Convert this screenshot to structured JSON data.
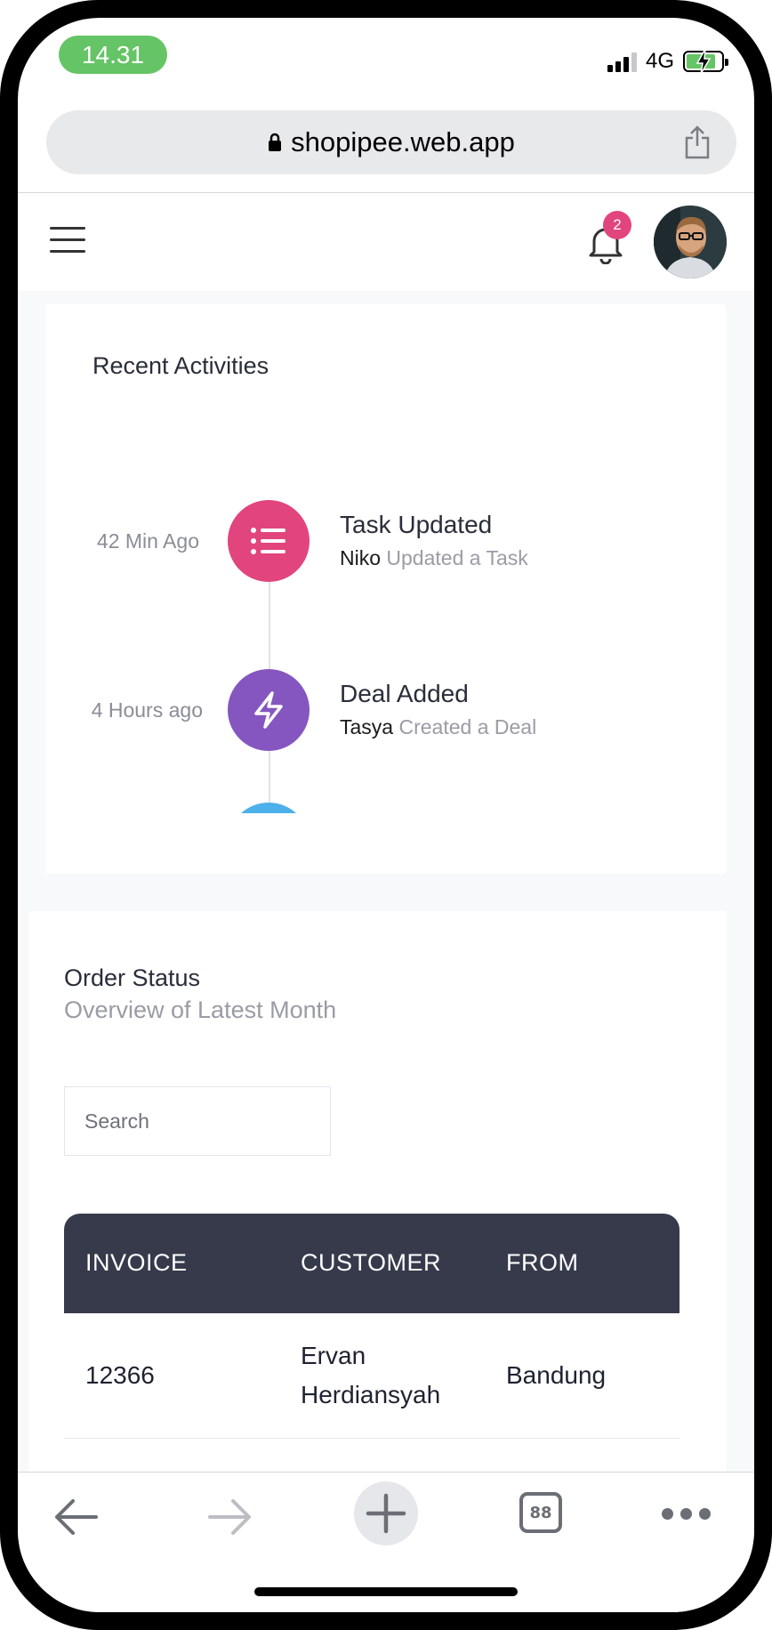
{
  "status_bar": {
    "time": "14.31",
    "network": "4G",
    "battery_color": "#65c466"
  },
  "browser": {
    "url": "shopipee.web.app",
    "tabs_count": "88"
  },
  "header": {
    "notification_count": "2",
    "badge_color": "#e2447e"
  },
  "recent_activities": {
    "title": "Recent Activities",
    "items": [
      {
        "time": "42 Min Ago",
        "title": "Task Updated",
        "actor": "Niko",
        "action": "Updated a Task",
        "icon": "list-icon",
        "color": "#e2447e"
      },
      {
        "time": "4 Hours ago",
        "title": "Deal Added",
        "actor": "Tasya",
        "action": "Created a Deal",
        "icon": "lightning-icon",
        "color": "#8556bf"
      },
      {
        "icon": "partial-circle",
        "color": "#4db0ea"
      }
    ]
  },
  "order_status": {
    "title": "Order Status",
    "subtitle": "Overview of Latest Month",
    "search_placeholder": "Search",
    "columns": [
      "INVOICE",
      "CUSTOMER",
      "FROM"
    ],
    "rows": [
      {
        "invoice": "12366",
        "customer_line1": "Ervan",
        "customer_line2": "Herdiansyah",
        "from": "Bandung"
      }
    ],
    "header_color": "#363a4b"
  }
}
